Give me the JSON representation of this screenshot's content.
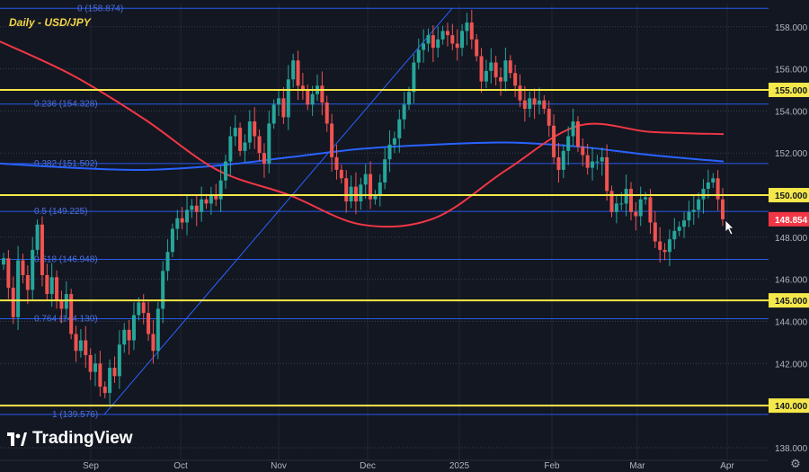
{
  "chart_data": {
    "type": "candlestick",
    "title": "Daily - USD/JPY",
    "x_ticks": [
      "Sep",
      "Oct",
      "Nov",
      "Dec",
      "2025",
      "Feb",
      "Mar",
      "Apr"
    ],
    "y_ticks": [
      "138.000",
      "140.000",
      "142.000",
      "144.000",
      "146.000",
      "148.000",
      "150.000",
      "152.000",
      "154.000",
      "155.000",
      "156.000",
      "158.000"
    ],
    "ylim": [
      137.4,
      159.1
    ],
    "last_price": "148.854",
    "horizontal_levels": [
      {
        "value": 155.0,
        "label": "155.000"
      },
      {
        "value": 150.0,
        "label": "150.000"
      },
      {
        "value": 145.0,
        "label": "145.000"
      },
      {
        "value": 140.0,
        "label": "140.000"
      }
    ],
    "fibonacci_levels": [
      {
        "ratio_label": "0 (158.874)",
        "value": 158.874
      },
      {
        "ratio_label": "0.236 (154.328)",
        "value": 154.328
      },
      {
        "ratio_label": "0.382 (151.502)",
        "value": 151.502
      },
      {
        "ratio_label": "0.5 (149.225)",
        "value": 149.225
      },
      {
        "ratio_label": "0.618 (146.948)",
        "value": 146.948
      },
      {
        "ratio_label": "0.764 (144.130)",
        "value": 144.13
      },
      {
        "ratio_label": "1 (139.576)",
        "value": 139.576
      }
    ],
    "close_series": [
      147.0,
      145.6,
      144.2,
      146.9,
      146.2,
      145.5,
      147.4,
      148.6,
      146.2,
      145.3,
      146.1,
      145.0,
      144.6,
      145.3,
      143.4,
      142.6,
      143.1,
      142.4,
      141.6,
      142.0,
      140.9,
      140.6,
      141.8,
      141.4,
      142.9,
      143.6,
      143.1,
      144.3,
      144.9,
      144.4,
      143.4,
      142.6,
      144.6,
      146.4,
      147.3,
      148.4,
      148.9,
      148.7,
      149.3,
      149.5,
      149.2,
      149.8,
      149.6,
      150.0,
      149.8,
      150.7,
      151.6,
      152.8,
      153.2,
      152.1,
      152.5,
      153.5,
      152.8,
      152.0,
      151.5,
      153.4,
      154.3,
      154.6,
      153.7,
      155.5,
      156.4,
      155.2,
      155.0,
      154.3,
      154.8,
      155.2,
      154.4,
      153.4,
      151.8,
      151.2,
      150.8,
      149.7,
      150.4,
      149.7,
      150.5,
      151.0,
      149.8,
      150.0,
      150.6,
      151.7,
      152.4,
      152.7,
      153.6,
      154.3,
      154.9,
      156.3,
      156.9,
      157.2,
      157.6,
      157.0,
      157.4,
      157.8,
      157.6,
      157.2,
      157.0,
      157.8,
      158.2,
      157.4,
      156.6,
      155.4,
      155.9,
      156.3,
      155.6,
      155.4,
      156.4,
      155.8,
      155.2,
      154.5,
      154.1,
      154.6,
      154.3,
      154.5,
      154.1,
      153.3,
      151.8,
      151.2,
      152.1,
      152.8,
      153.5,
      152.3,
      151.9,
      151.3,
      151.6,
      151.6,
      151.8,
      150.2,
      149.2,
      149.6,
      149.6,
      150.3,
      149.2,
      149.0,
      149.8,
      149.9,
      148.7,
      147.8,
      147.4,
      147.3,
      147.9,
      148.3,
      148.5,
      148.8,
      149.2,
      149.3,
      149.8,
      150.3,
      150.6,
      150.8,
      149.8,
      148.854
    ],
    "moving_averages": [
      {
        "color": "#2962ff",
        "values": [
          151.5,
          151.3,
          151.2,
          151.4,
          151.8,
          152.2,
          152.4,
          152.5,
          152.3,
          151.9,
          151.6
        ]
      },
      {
        "color": "#f23645",
        "values": [
          157.3,
          155.7,
          153.6,
          151.2,
          150.0,
          148.6,
          148.9,
          151.2,
          153.3,
          153.0,
          152.9
        ]
      }
    ],
    "trendline": {
      "from": [
        139.576,
        "Sep"
      ],
      "to": [
        158.874,
        "2025"
      ]
    }
  },
  "branding": {
    "logo_text": "TradingView"
  },
  "ui": {
    "settings_icon": "gear-icon"
  },
  "colors": {
    "background": "#131722",
    "bull": "#26a69a",
    "bear": "#ef5350",
    "level": "#f5e84a",
    "fib": "#2962ff",
    "price_label": "#f23645"
  }
}
